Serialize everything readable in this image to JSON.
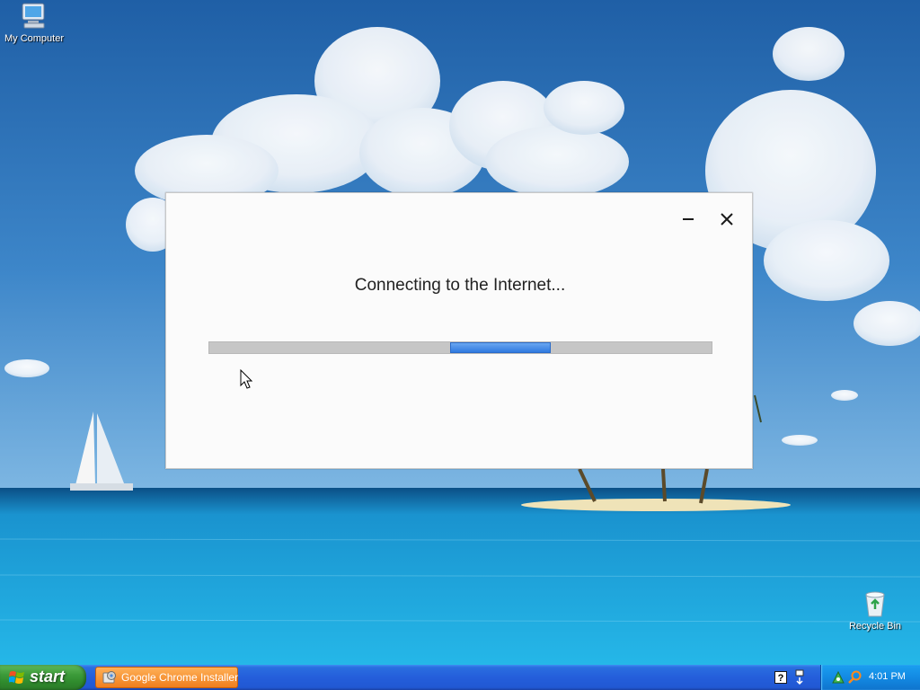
{
  "desktop": {
    "icons": [
      {
        "label": "My Computer"
      },
      {
        "label": "Recycle Bin"
      }
    ]
  },
  "installer": {
    "status_text": "Connecting to the Internet...",
    "progress_style": "marquee",
    "accent_color": "#3a86e8"
  },
  "taskbar": {
    "start_label": "start",
    "tasks": [
      {
        "label": "Google Chrome Installer",
        "active": true
      }
    ],
    "tray": {
      "clock": "4:01 PM",
      "icons": [
        "help-icon",
        "safely-remove-icon",
        "network-icon",
        "search-icon"
      ]
    }
  }
}
